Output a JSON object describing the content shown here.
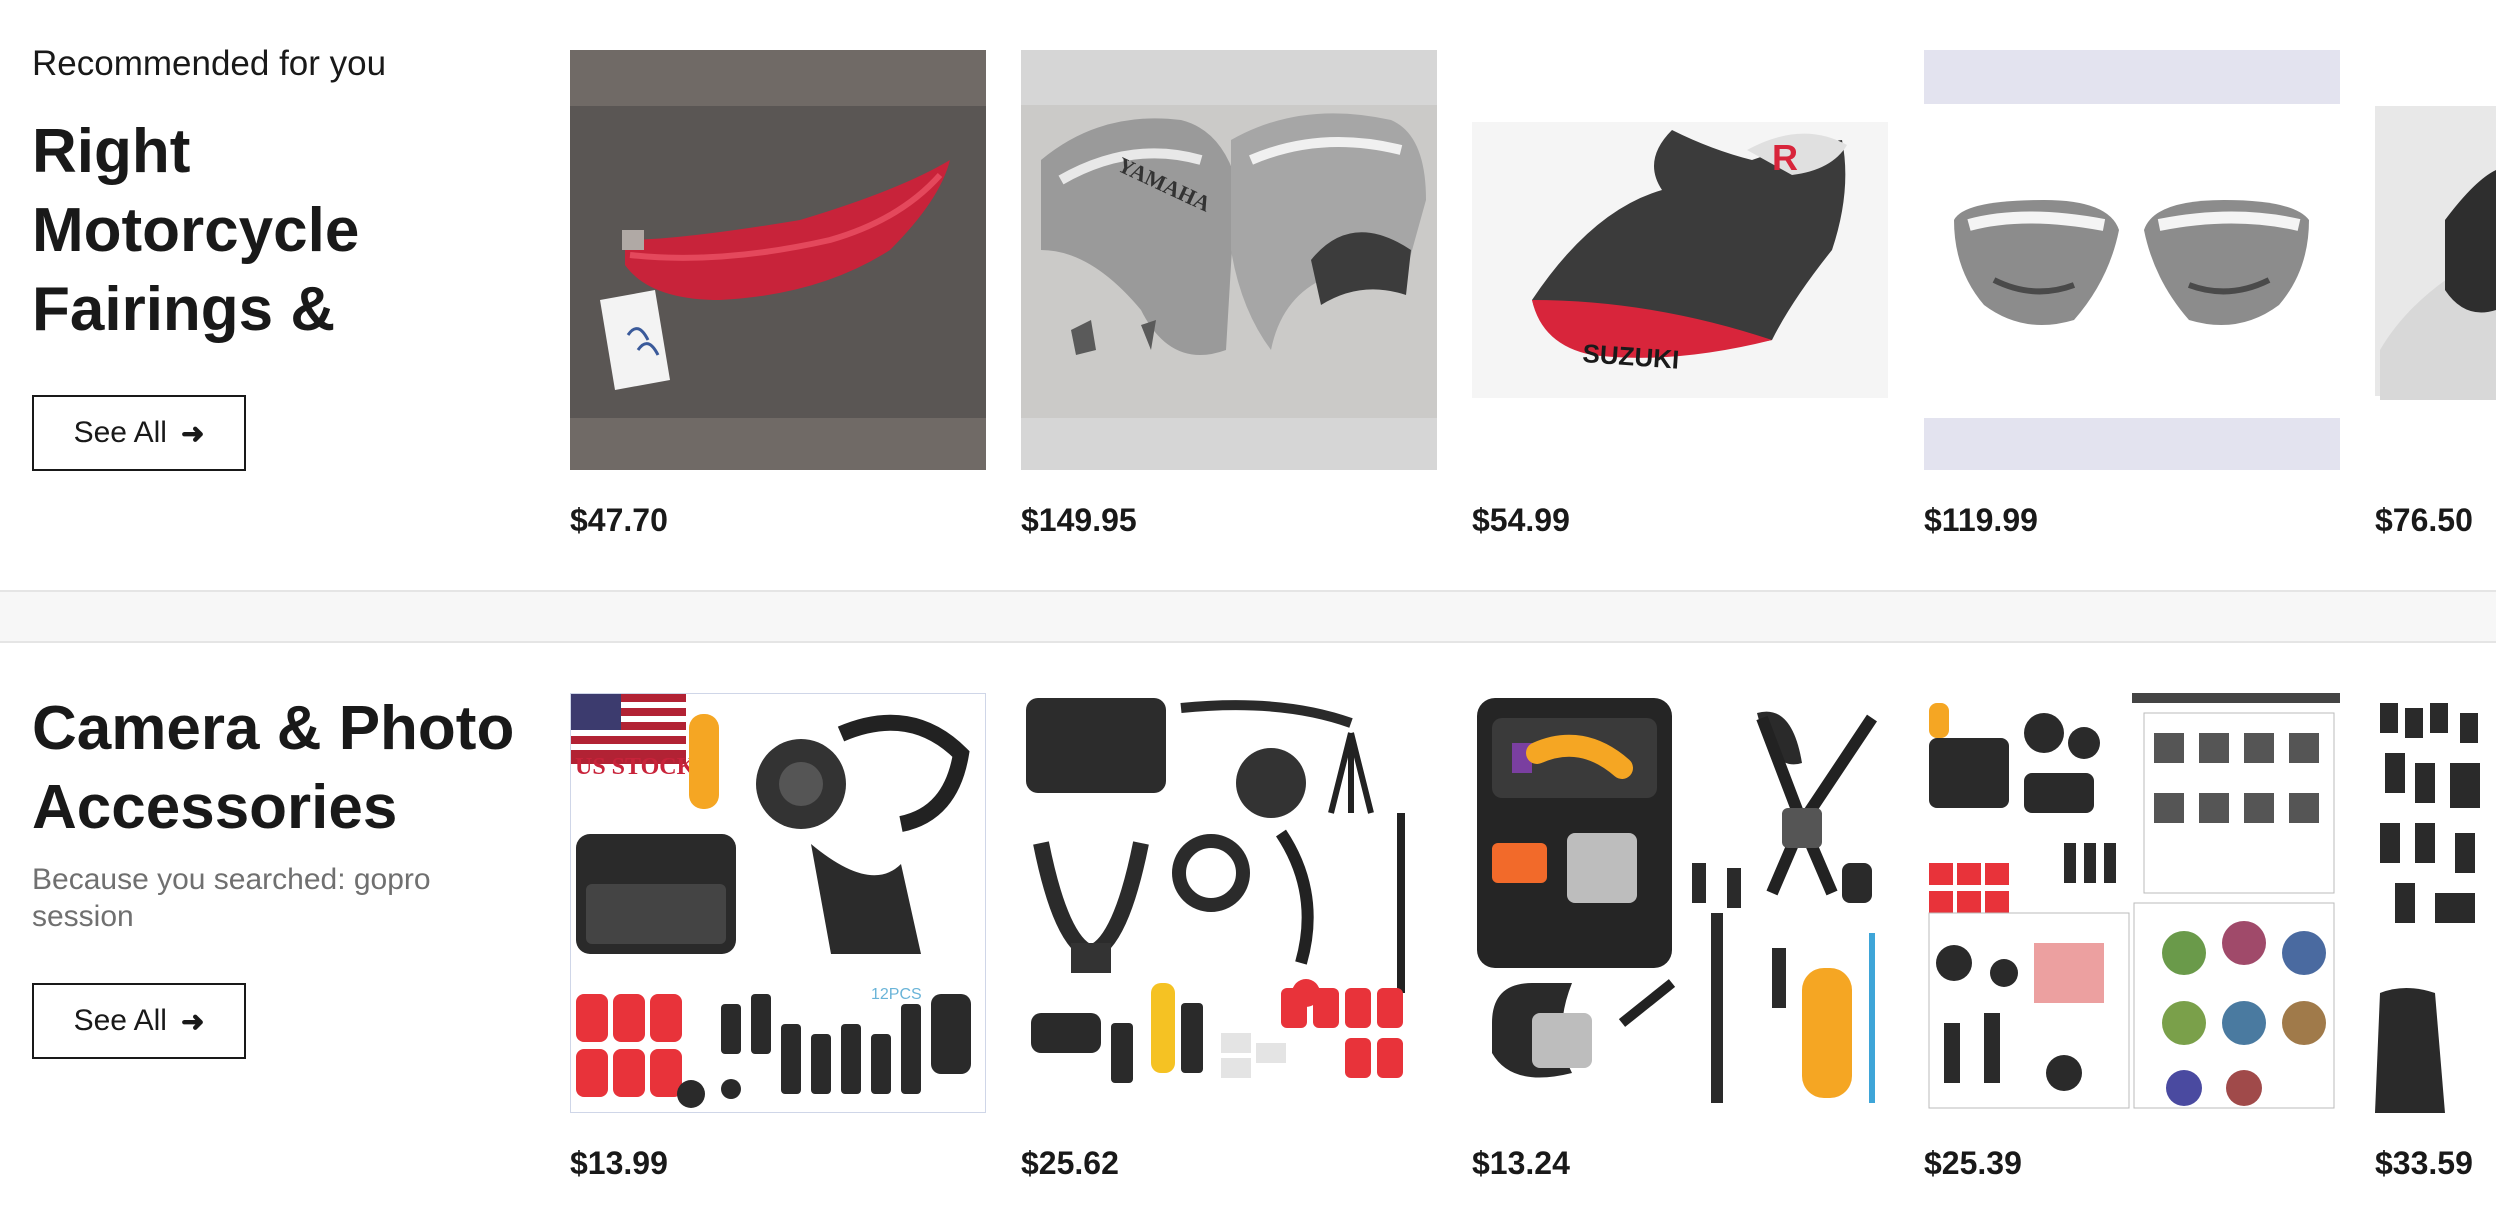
{
  "section1": {
    "eyebrow": "Recommended for you",
    "title_lines": [
      "Right",
      "Motorcycle",
      "Fairings &"
    ],
    "see_all": "See All",
    "items": [
      {
        "price": "$47.70",
        "image": "red-tail-fairing"
      },
      {
        "price": "$149.95",
        "image": "chrome-yamaha-covers",
        "image_text": "YAMAHA"
      },
      {
        "price": "$54.99",
        "image": "suzuki-side-fairing",
        "image_text": "SUZUKI"
      },
      {
        "price": "$119.99",
        "image": "chrome-side-covers"
      },
      {
        "price": "$76.50",
        "image": "partial-fairing"
      }
    ]
  },
  "section2": {
    "title_lines": [
      "Camera & Photo",
      "Accessories"
    ],
    "subtitle_lines": [
      "Because you searched: gopro",
      "session"
    ],
    "see_all": "See All",
    "items": [
      {
        "price": "$13.99",
        "image": "camera-accessory-kit-us-stock",
        "image_text": "US STOCK"
      },
      {
        "price": "$25.62",
        "image": "camera-accessory-kit"
      },
      {
        "price": "$13.24",
        "image": "camera-accessory-kit-case"
      },
      {
        "price": "$25.39",
        "image": "camera-accessory-kit-packing-list"
      },
      {
        "price": "$33.59",
        "image": "camera-accessory-kit-partial"
      }
    ]
  },
  "colors": {
    "text": "#191919",
    "muted": "#707070",
    "divider": "#e5e5e5",
    "page_bg": "#f7f7f7"
  }
}
